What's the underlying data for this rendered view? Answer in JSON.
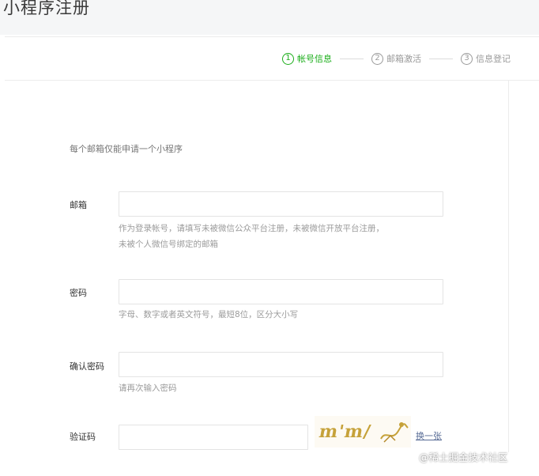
{
  "page_title": "小程序注册",
  "steps": [
    {
      "num": "1",
      "label": "帐号信息",
      "active": true
    },
    {
      "num": "2",
      "label": "邮箱激活",
      "active": false
    },
    {
      "num": "3",
      "label": "信息登记",
      "active": false
    }
  ],
  "intro": "每个邮箱仅能申请一个小程序",
  "form": {
    "email": {
      "label": "邮箱",
      "value": "",
      "hint_line1": "作为登录帐号，请填写未被微信公众平台注册，未被微信开放平台注册，",
      "hint_line2": "未被个人微信号绑定的邮箱"
    },
    "password": {
      "label": "密码",
      "value": "",
      "hint": "字母、数字或者英文符号，最短8位，区分大小写"
    },
    "confirm_password": {
      "label": "确认密码",
      "value": "",
      "hint": "请再次输入密码"
    },
    "captcha": {
      "label": "验证码",
      "value": "",
      "image_text": "m'm/",
      "refresh_label": "换一张"
    }
  },
  "watermark": "@稀土掘金技术社区",
  "colors": {
    "accent": "#1aad19",
    "link": "#576b95",
    "hint": "#9b9b9b"
  }
}
